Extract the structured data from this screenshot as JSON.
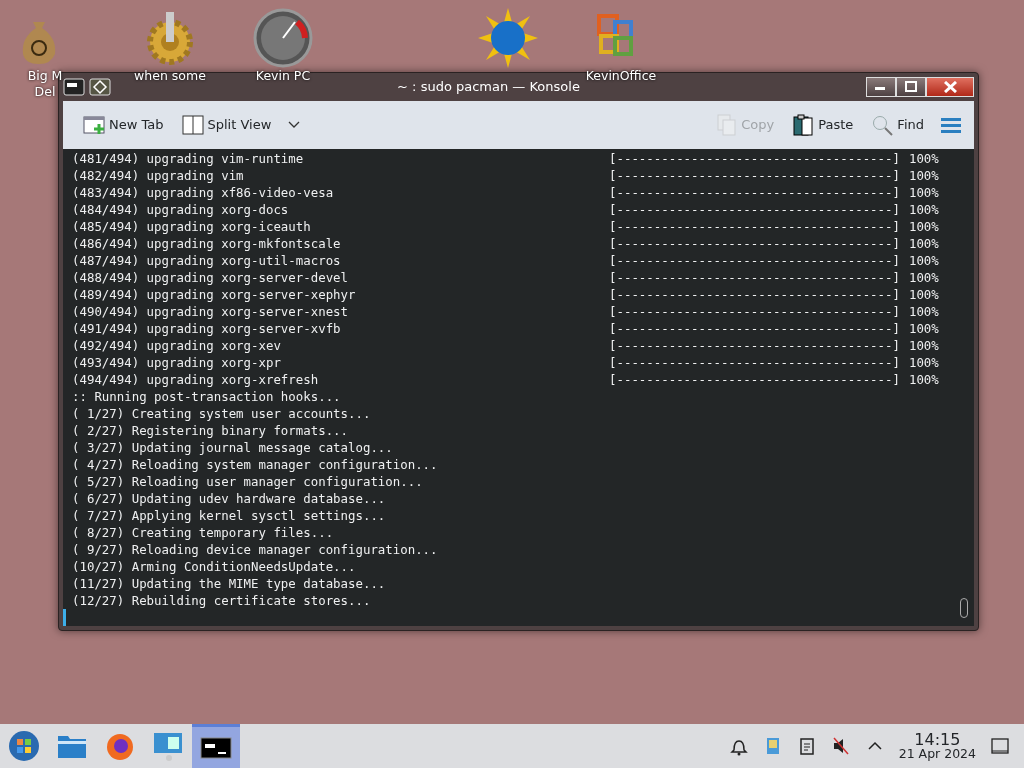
{
  "desktop_icons": [
    {
      "kind": "money",
      "label": [
        "Big M",
        "Del"
      ]
    },
    {
      "kind": "gear",
      "label": [
        "when some"
      ]
    },
    {
      "kind": "gauge",
      "label": [
        "Kevin PC"
      ]
    },
    {
      "kind": "globe"
    },
    {
      "kind": "office",
      "label": [
        "KevinOffice"
      ]
    }
  ],
  "window": {
    "title": "~ : sudo pacman — Konsole"
  },
  "toolbar": {
    "left": [
      {
        "kind": "newtab",
        "label": "New Tab",
        "disabled": false
      },
      {
        "kind": "split",
        "label": "Split View",
        "disabled": false
      }
    ],
    "right": [
      {
        "kind": "copy",
        "label": "Copy",
        "disabled": true
      },
      {
        "kind": "paste",
        "label": "Paste",
        "disabled": false
      },
      {
        "kind": "find",
        "label": "Find",
        "disabled": false
      }
    ]
  },
  "terminal": {
    "lines": [
      {
        "kind": "progress",
        "text": "(481/494) upgrading vim-runtime",
        "bar": "[-------------------------------------]",
        "percent": "100%"
      },
      {
        "kind": "progress",
        "text": "(482/494) upgrading vim",
        "bar": "[-------------------------------------]",
        "percent": "100%"
      },
      {
        "kind": "progress",
        "text": "(483/494) upgrading xf86-video-vesa",
        "bar": "[-------------------------------------]",
        "percent": "100%"
      },
      {
        "kind": "progress",
        "text": "(484/494) upgrading xorg-docs",
        "bar": "[-------------------------------------]",
        "percent": "100%"
      },
      {
        "kind": "progress",
        "text": "(485/494) upgrading xorg-iceauth",
        "bar": "[-------------------------------------]",
        "percent": "100%"
      },
      {
        "kind": "progress",
        "text": "(486/494) upgrading xorg-mkfontscale",
        "bar": "[-------------------------------------]",
        "percent": "100%"
      },
      {
        "kind": "progress",
        "text": "(487/494) upgrading xorg-util-macros",
        "bar": "[-------------------------------------]",
        "percent": "100%"
      },
      {
        "kind": "progress",
        "text": "(488/494) upgrading xorg-server-devel",
        "bar": "[-------------------------------------]",
        "percent": "100%"
      },
      {
        "kind": "progress",
        "text": "(489/494) upgrading xorg-server-xephyr",
        "bar": "[-------------------------------------]",
        "percent": "100%"
      },
      {
        "kind": "progress",
        "text": "(490/494) upgrading xorg-server-xnest",
        "bar": "[-------------------------------------]",
        "percent": "100%"
      },
      {
        "kind": "progress",
        "text": "(491/494) upgrading xorg-server-xvfb",
        "bar": "[-------------------------------------]",
        "percent": "100%"
      },
      {
        "kind": "progress",
        "text": "(492/494) upgrading xorg-xev",
        "bar": "[-------------------------------------]",
        "percent": "100%"
      },
      {
        "kind": "progress",
        "text": "(493/494) upgrading xorg-xpr",
        "bar": "[-------------------------------------]",
        "percent": "100%"
      },
      {
        "kind": "progress",
        "text": "(494/494) upgrading xorg-xrefresh",
        "bar": "[-------------------------------------]",
        "percent": "100%"
      },
      {
        "kind": "plain",
        "text": ":: Running post-transaction hooks..."
      },
      {
        "kind": "plain",
        "text": "( 1/27) Creating system user accounts..."
      },
      {
        "kind": "plain",
        "text": "( 2/27) Registering binary formats..."
      },
      {
        "kind": "plain",
        "text": "( 3/27) Updating journal message catalog..."
      },
      {
        "kind": "plain",
        "text": "( 4/27) Reloading system manager configuration..."
      },
      {
        "kind": "plain",
        "text": "( 5/27) Reloading user manager configuration..."
      },
      {
        "kind": "plain",
        "text": "( 6/27) Updating udev hardware database..."
      },
      {
        "kind": "plain",
        "text": "( 7/27) Applying kernel sysctl settings..."
      },
      {
        "kind": "plain",
        "text": "( 8/27) Creating temporary files..."
      },
      {
        "kind": "plain",
        "text": "( 9/27) Reloading device manager configuration..."
      },
      {
        "kind": "plain",
        "text": "(10/27) Arming ConditionNeedsUpdate..."
      },
      {
        "kind": "plain",
        "text": "(11/27) Updating the MIME type database..."
      },
      {
        "kind": "plain",
        "text": "(12/27) Rebuilding certificate stores..."
      }
    ]
  },
  "taskbar": {
    "items": [
      {
        "kind": "start",
        "selected": false
      },
      {
        "kind": "files",
        "selected": false
      },
      {
        "kind": "browser",
        "selected": false
      },
      {
        "kind": "monitor",
        "selected": false
      },
      {
        "kind": "terminal",
        "selected": true
      }
    ],
    "tray": [
      {
        "kind": "bell"
      },
      {
        "kind": "updates"
      },
      {
        "kind": "clipboard"
      },
      {
        "kind": "muted"
      },
      {
        "kind": "expand"
      }
    ],
    "time": "14:15",
    "date": "21 Apr 2024"
  }
}
